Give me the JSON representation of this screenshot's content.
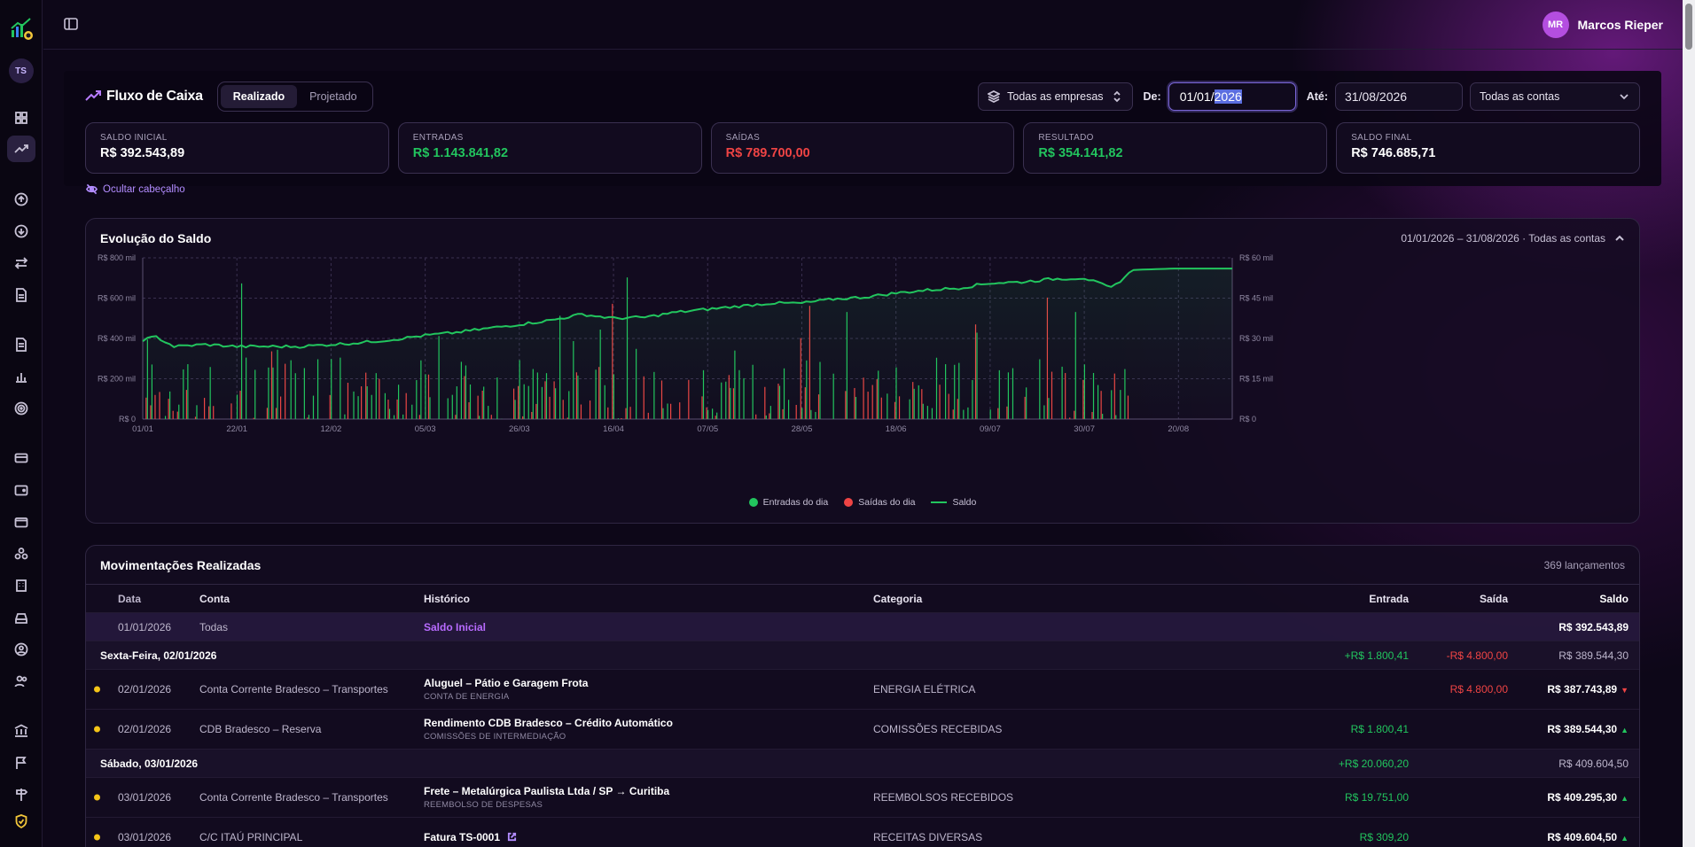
{
  "user": {
    "initials": "MR",
    "name": "Marcos Rieper"
  },
  "workspace": {
    "initials": "TS"
  },
  "header": {
    "title": "Fluxo de Caixa",
    "modes": [
      {
        "label": "Realizado",
        "active": true
      },
      {
        "label": "Projetado",
        "active": false
      }
    ],
    "company_filter": "Todas as empresas",
    "from_label": "De:",
    "from_value_prefix": "01/01/",
    "from_value_selected": "2026",
    "to_label": "Até:",
    "to_value": "31/08/2026",
    "accounts_filter": "Todas as contas"
  },
  "summary": [
    {
      "label": "SALDO INICIAL",
      "value": "R$ 392.543,89",
      "tone": "neutral"
    },
    {
      "label": "ENTRADAS",
      "value": "R$ 1.143.841,82",
      "tone": "green"
    },
    {
      "label": "SAÍDAS",
      "value": "R$ 789.700,00",
      "tone": "red"
    },
    {
      "label": "RESULTADO",
      "value": "R$ 354.141,82",
      "tone": "green"
    },
    {
      "label": "SALDO FINAL",
      "value": "R$ 746.685,71",
      "tone": "neutral"
    }
  ],
  "hide_header_label": "Ocultar cabeçalho",
  "chart_data": {
    "type": "line",
    "title": "Evolução do Saldo",
    "meta": "01/01/2026 – 31/08/2026 · Todas as contas",
    "x_ticks": [
      "01/01",
      "22/01",
      "12/02",
      "05/03",
      "26/03",
      "16/04",
      "07/05",
      "28/05",
      "18/06",
      "09/07",
      "30/07",
      "20/08"
    ],
    "y_left_ticks": [
      "R$ 0",
      "R$ 200 mil",
      "R$ 400 mil",
      "R$ 600 mil",
      "R$ 800 mil"
    ],
    "y_left_range": [
      0,
      800000
    ],
    "y_right_ticks": [
      "R$ 0",
      "R$ 15 mil",
      "R$ 30 mil",
      "R$ 45 mil",
      "R$ 60 mil"
    ],
    "y_right_range": [
      0,
      60000
    ],
    "grid": true,
    "legend_position": "bottom",
    "series": [
      {
        "name": "Entradas do dia",
        "type": "bar",
        "axis": "right",
        "color": "#22c55e"
      },
      {
        "name": "Saídas do dia",
        "type": "bar",
        "axis": "right",
        "color": "#ef4444"
      },
      {
        "name": "Saldo",
        "type": "line",
        "axis": "left",
        "color": "#22c55e",
        "points": [
          [
            0,
            392544
          ],
          [
            3,
            408000
          ],
          [
            7,
            360000
          ],
          [
            14,
            370000
          ],
          [
            21,
            360000
          ],
          [
            35,
            360000
          ],
          [
            42,
            370000
          ],
          [
            49,
            380000
          ],
          [
            56,
            395000
          ],
          [
            63,
            415000
          ],
          [
            70,
            430000
          ],
          [
            77,
            450000
          ],
          [
            84,
            470000
          ],
          [
            91,
            490000
          ],
          [
            98,
            520000
          ],
          [
            105,
            500000
          ],
          [
            112,
            505000
          ],
          [
            119,
            530000
          ],
          [
            126,
            545000
          ],
          [
            133,
            560000
          ],
          [
            140,
            575000
          ],
          [
            147,
            575000
          ],
          [
            154,
            595000
          ],
          [
            161,
            605000
          ],
          [
            168,
            625000
          ],
          [
            175,
            640000
          ],
          [
            182,
            650000
          ],
          [
            189,
            675000
          ],
          [
            196,
            680000
          ],
          [
            203,
            695000
          ],
          [
            210,
            700000
          ],
          [
            216,
            650000
          ],
          [
            221,
            740000
          ],
          [
            230,
            746686
          ],
          [
            243,
            746686
          ]
        ]
      }
    ]
  },
  "movements": {
    "title": "Movimentações Realizadas",
    "count": "369 lançamentos",
    "columns": {
      "date": "Data",
      "account": "Conta",
      "history": "Histórico",
      "category": "Categoria",
      "in": "Entrada",
      "out": "Saída",
      "balance": "Saldo"
    },
    "initial": {
      "date": "01/01/2026",
      "account": "Todas",
      "history": "Saldo Inicial",
      "balance": "R$ 392.543,89"
    },
    "groups": [
      {
        "label": "Sexta-Feira, 02/01/2026",
        "in": "+R$ 1.800,41",
        "out": "-R$ 4.800,00",
        "balance": "R$ 389.544,30",
        "rows": [
          {
            "date": "02/01/2026",
            "account": "Conta Corrente Bradesco – Transportes",
            "history": "Aluguel – Pátio e Garagem Frota",
            "sub": "CONTA DE ENERGIA",
            "category": "ENERGIA ELÉTRICA",
            "in": "",
            "out": "R$ 4.800,00",
            "balance": "R$ 387.743,89",
            "trend": "down"
          },
          {
            "date": "02/01/2026",
            "account": "CDB Bradesco – Reserva",
            "history": "Rendimento CDB Bradesco – Crédito Automático",
            "sub": "COMISSÕES DE INTERMEDIAÇÃO",
            "category": "COMISSÕES RECEBIDAS",
            "in": "R$ 1.800,41",
            "out": "",
            "balance": "R$ 389.544,30",
            "trend": "up"
          }
        ]
      },
      {
        "label": "Sábado, 03/01/2026",
        "in": "+R$ 20.060,20",
        "out": "",
        "balance": "R$ 409.604,50",
        "rows": [
          {
            "date": "03/01/2026",
            "account": "Conta Corrente Bradesco – Transportes",
            "history": "Frete – Metalúrgica Paulista Ltda / SP → Curitiba",
            "sub": "REEMBOLSO DE DESPESAS",
            "category": "REEMBOLSOS RECEBIDOS",
            "in": "R$ 19.751,00",
            "out": "",
            "balance": "R$ 409.295,30",
            "trend": "up"
          },
          {
            "date": "03/01/2026",
            "account": "C/C ITAÚ PRINCIPAL",
            "history": "Fatura TS-0001",
            "sub": "",
            "category": "RECEITAS DIVERSAS",
            "in": "R$ 309,20",
            "out": "",
            "balance": "R$ 409.604,50",
            "trend": "up"
          }
        ]
      }
    ]
  }
}
